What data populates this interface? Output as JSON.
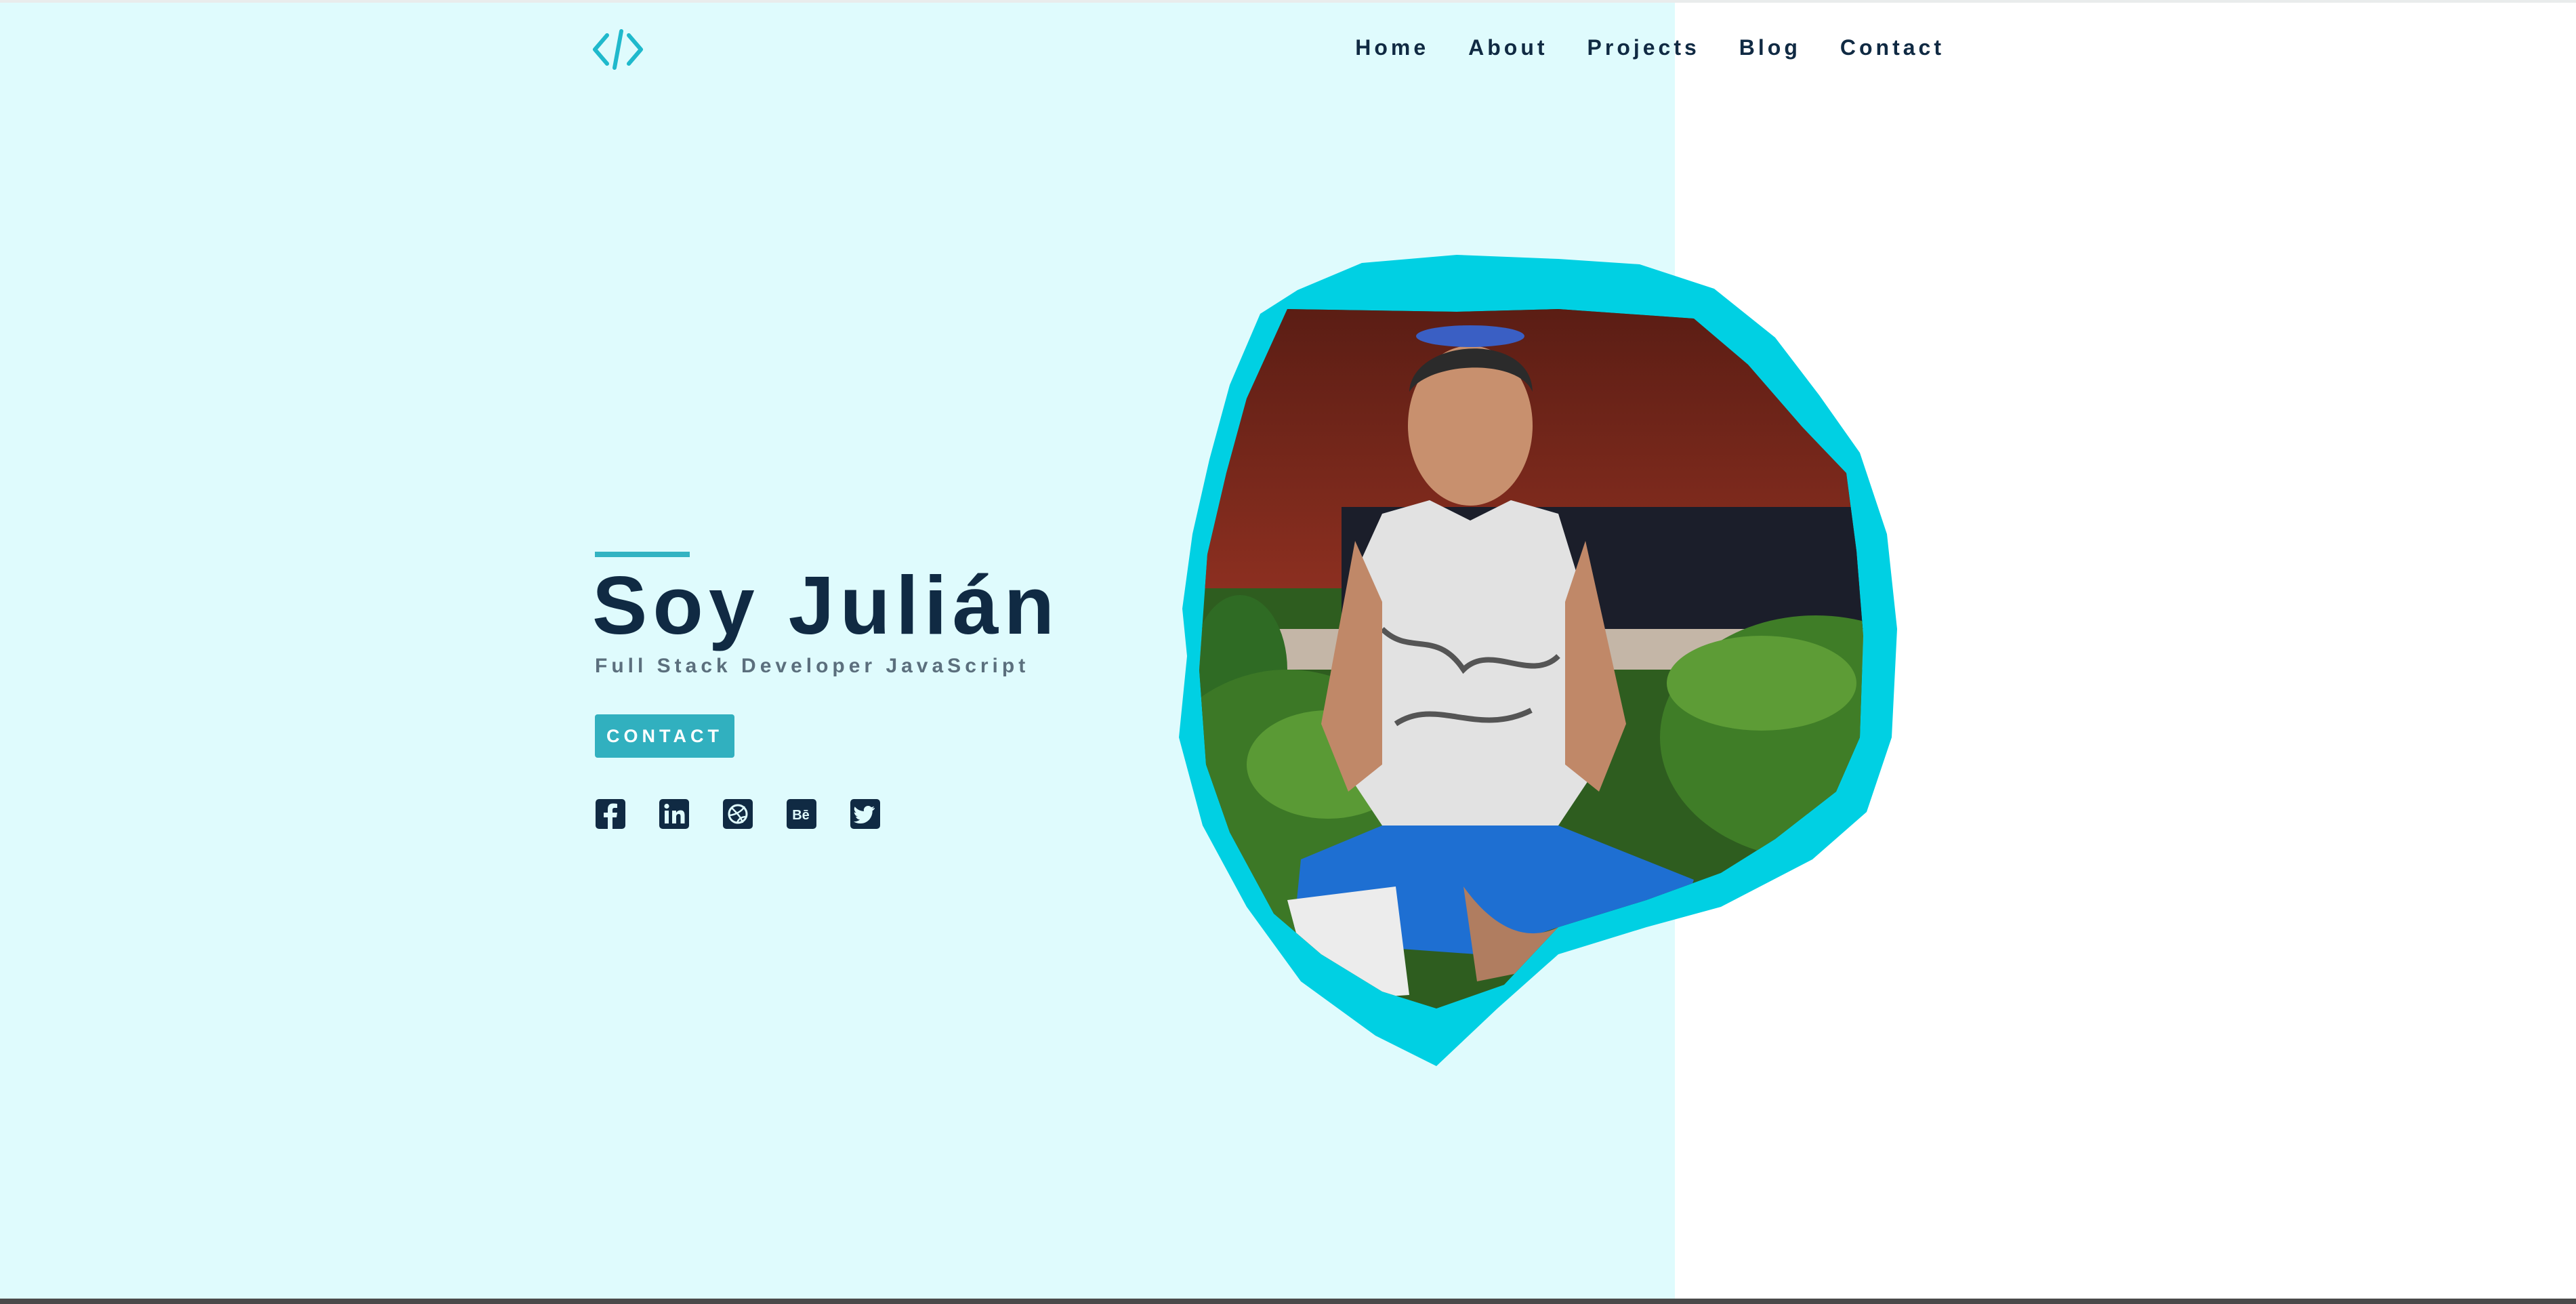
{
  "header": {
    "logo_icon": "code-brackets-icon",
    "nav": [
      {
        "label": "Home"
      },
      {
        "label": "About"
      },
      {
        "label": "Projects"
      },
      {
        "label": "Blog"
      },
      {
        "label": "Contact"
      }
    ]
  },
  "hero": {
    "title": "Soy Julián",
    "subtitle": "Full Stack Developer JavaScript",
    "contact_button": "CONTACT",
    "socials": [
      {
        "icon": "facebook-icon"
      },
      {
        "icon": "linkedin-icon"
      },
      {
        "icon": "dribbble-icon"
      },
      {
        "icon": "behance-icon"
      },
      {
        "icon": "twitter-icon"
      }
    ]
  },
  "colors": {
    "accent": "#33b3c2",
    "accent_bright": "#00d0e3",
    "panel_background": "#dffbfd",
    "text_dark": "#102a43",
    "text_muted": "#5b6f7d"
  }
}
